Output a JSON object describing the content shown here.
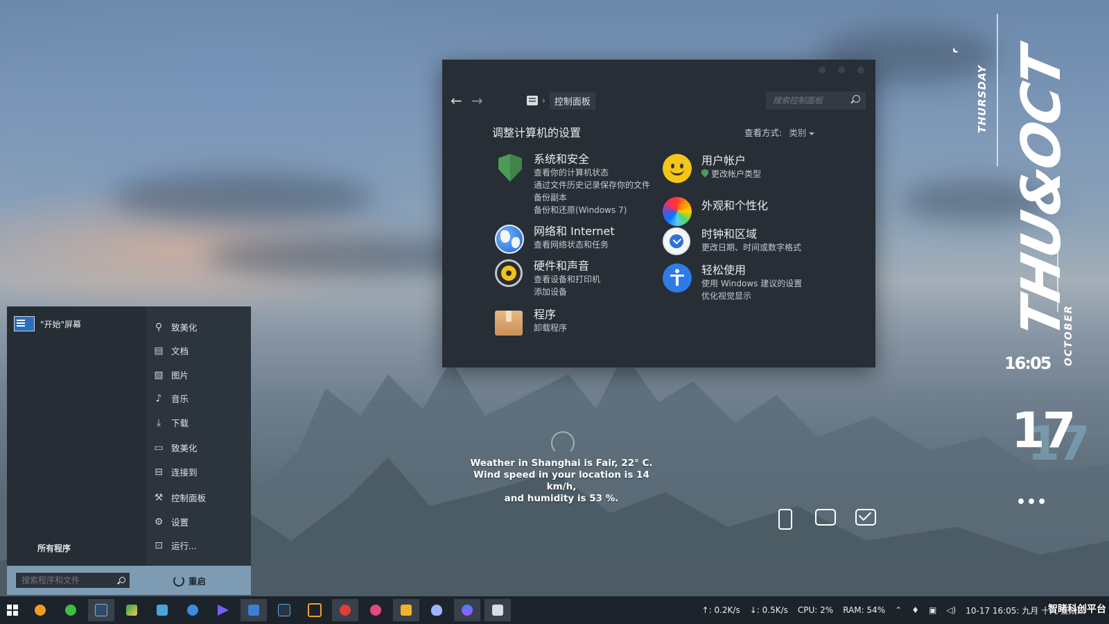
{
  "control_panel": {
    "breadcrumb": "控制面板",
    "search_placeholder": "搜索控制面板",
    "heading": "调整计算机的设置",
    "view_label": "查看方式:",
    "view_value": "类别",
    "categories_left": [
      {
        "title": "系统和安全",
        "icon": "shield-icon",
        "links": [
          "查看你的计算机状态",
          "通过文件历史记录保存你的文件备份副本",
          "备份和还原(Windows 7)"
        ]
      },
      {
        "title": "网络和 Internet",
        "icon": "globe-icon",
        "links": [
          "查看网络状态和任务"
        ]
      },
      {
        "title": "硬件和声音",
        "icon": "speaker-icon",
        "links": [
          "查看设备和打印机",
          "添加设备"
        ]
      },
      {
        "title": "程序",
        "icon": "box-icon",
        "links": [
          "卸载程序"
        ]
      }
    ],
    "categories_right": [
      {
        "title": "用户帐户",
        "icon": "smile-icon",
        "links": [
          "更改帐户类型"
        ]
      },
      {
        "title": "外观和个性化",
        "icon": "color-wheel-icon",
        "links": []
      },
      {
        "title": "时钟和区域",
        "icon": "clock-icon",
        "links": [
          "更改日期、时间或数字格式"
        ]
      },
      {
        "title": "轻松使用",
        "icon": "accessibility-icon",
        "links": [
          "使用 Windows 建议的设置",
          "优化视觉显示"
        ]
      }
    ]
  },
  "start_menu": {
    "user_label": "\"开始\"屏幕",
    "all_programs": "所有程序",
    "items": [
      {
        "label": "致美化",
        "icon": "pin-icon"
      },
      {
        "label": "文档",
        "icon": "document-icon"
      },
      {
        "label": "图片",
        "icon": "picture-icon"
      },
      {
        "label": "音乐",
        "icon": "music-icon"
      },
      {
        "label": "下载",
        "icon": "download-icon"
      },
      {
        "label": "致美化",
        "icon": "computer-icon"
      },
      {
        "label": "连接到",
        "icon": "connect-icon"
      },
      {
        "label": "控制面板",
        "icon": "wrench-icon"
      },
      {
        "label": "设置",
        "icon": "gear-icon"
      },
      {
        "label": "运行...",
        "icon": "run-icon"
      }
    ],
    "search_placeholder": "搜索程序和文件",
    "restart_label": "重启"
  },
  "weather": {
    "line1": "Weather in Shanghai is Fair, 22° C.",
    "line2": "Wind speed in your location is 14 km/h,",
    "line3": "and humidity is 53 %."
  },
  "widget": {
    "thursday": "THURSDAY",
    "big": "THU&OCT",
    "october": "OCTOBER",
    "time": "16:05",
    "day": "17",
    "more": "•••"
  },
  "taskbar": {
    "apps": [
      "paint-icon",
      "wechat-icon",
      "photoshop-icon",
      "chart-icon",
      "photos-icon",
      "palette-icon",
      "media-icon",
      "calculator-icon",
      "terminal-icon",
      "window-icon",
      "netease-icon",
      "xiu-icon",
      "folder-icon",
      "qq-icon",
      "browser-icon",
      "control-panel-icon"
    ],
    "upload": "↑: 0.2K/s",
    "download": "↓: 0.5K/s",
    "cpu": "CPU: 2%",
    "ram": "RAM: 54%",
    "datetime": "10-17  16:05:  九月 十九  星期四"
  },
  "watermark": "智睹科创平台",
  "colors": {
    "window_bg": "#272e36",
    "start_bottom": "#7e9bb4",
    "taskbar": "#1d232a",
    "accent_green": "#4e9a58",
    "accent_blue": "#2e7be8"
  }
}
